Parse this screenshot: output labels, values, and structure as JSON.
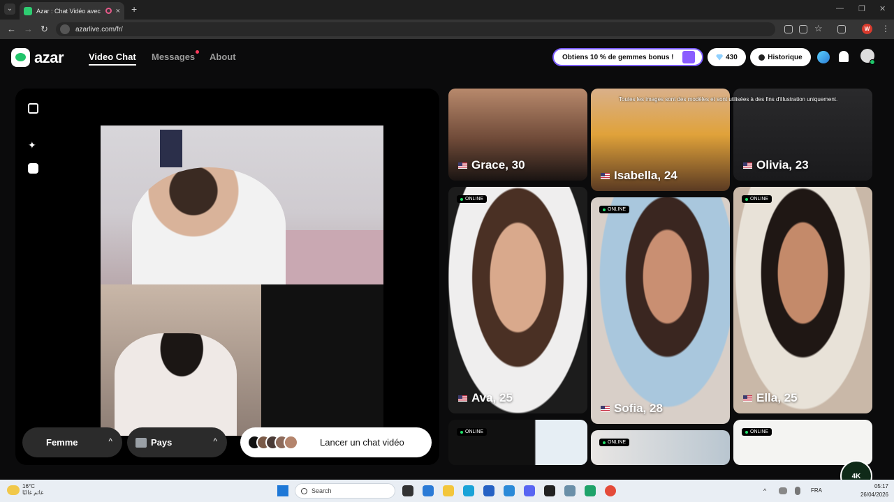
{
  "browser": {
    "tab_title": "Azar : Chat Vidéo avec de n",
    "tab_close": "×",
    "new_tab": "+",
    "url": "azarlive.com/fr/",
    "profile_initial": "W",
    "window_controls": [
      "—",
      "❐",
      "✕"
    ]
  },
  "header": {
    "logo_text": "azar",
    "nav": {
      "video_chat": "Video Chat",
      "messages": "Messages",
      "about": "About"
    },
    "promo_text": "Obtiens 10 % de gemmes bonus !",
    "gems_count": "430",
    "history_label": "Historique"
  },
  "controls": {
    "gender_label": "Femme",
    "country_label": "Pays",
    "start_label": "Lancer un chat vidéo",
    "chevron": "^"
  },
  "disclaimer": "Toutes les images sont des modèles et sont utilisées à des fins d'illustration uniquement.",
  "online_label": "ONLINE",
  "profiles": {
    "grace": "Grace, 30",
    "isabella": "Isabella, 24",
    "olivia": "Olivia, 23",
    "ava": "Ava, 25",
    "sofia": "Sofia, 28",
    "ella": "Ella, 25"
  },
  "taskbar": {
    "weather_temp": "16°C",
    "weather_desc": "غائم غالبًا",
    "search_label": "Search",
    "lang": "FRA",
    "time": "05:17",
    "date": "26/04/2026"
  },
  "watermark": "4K"
}
